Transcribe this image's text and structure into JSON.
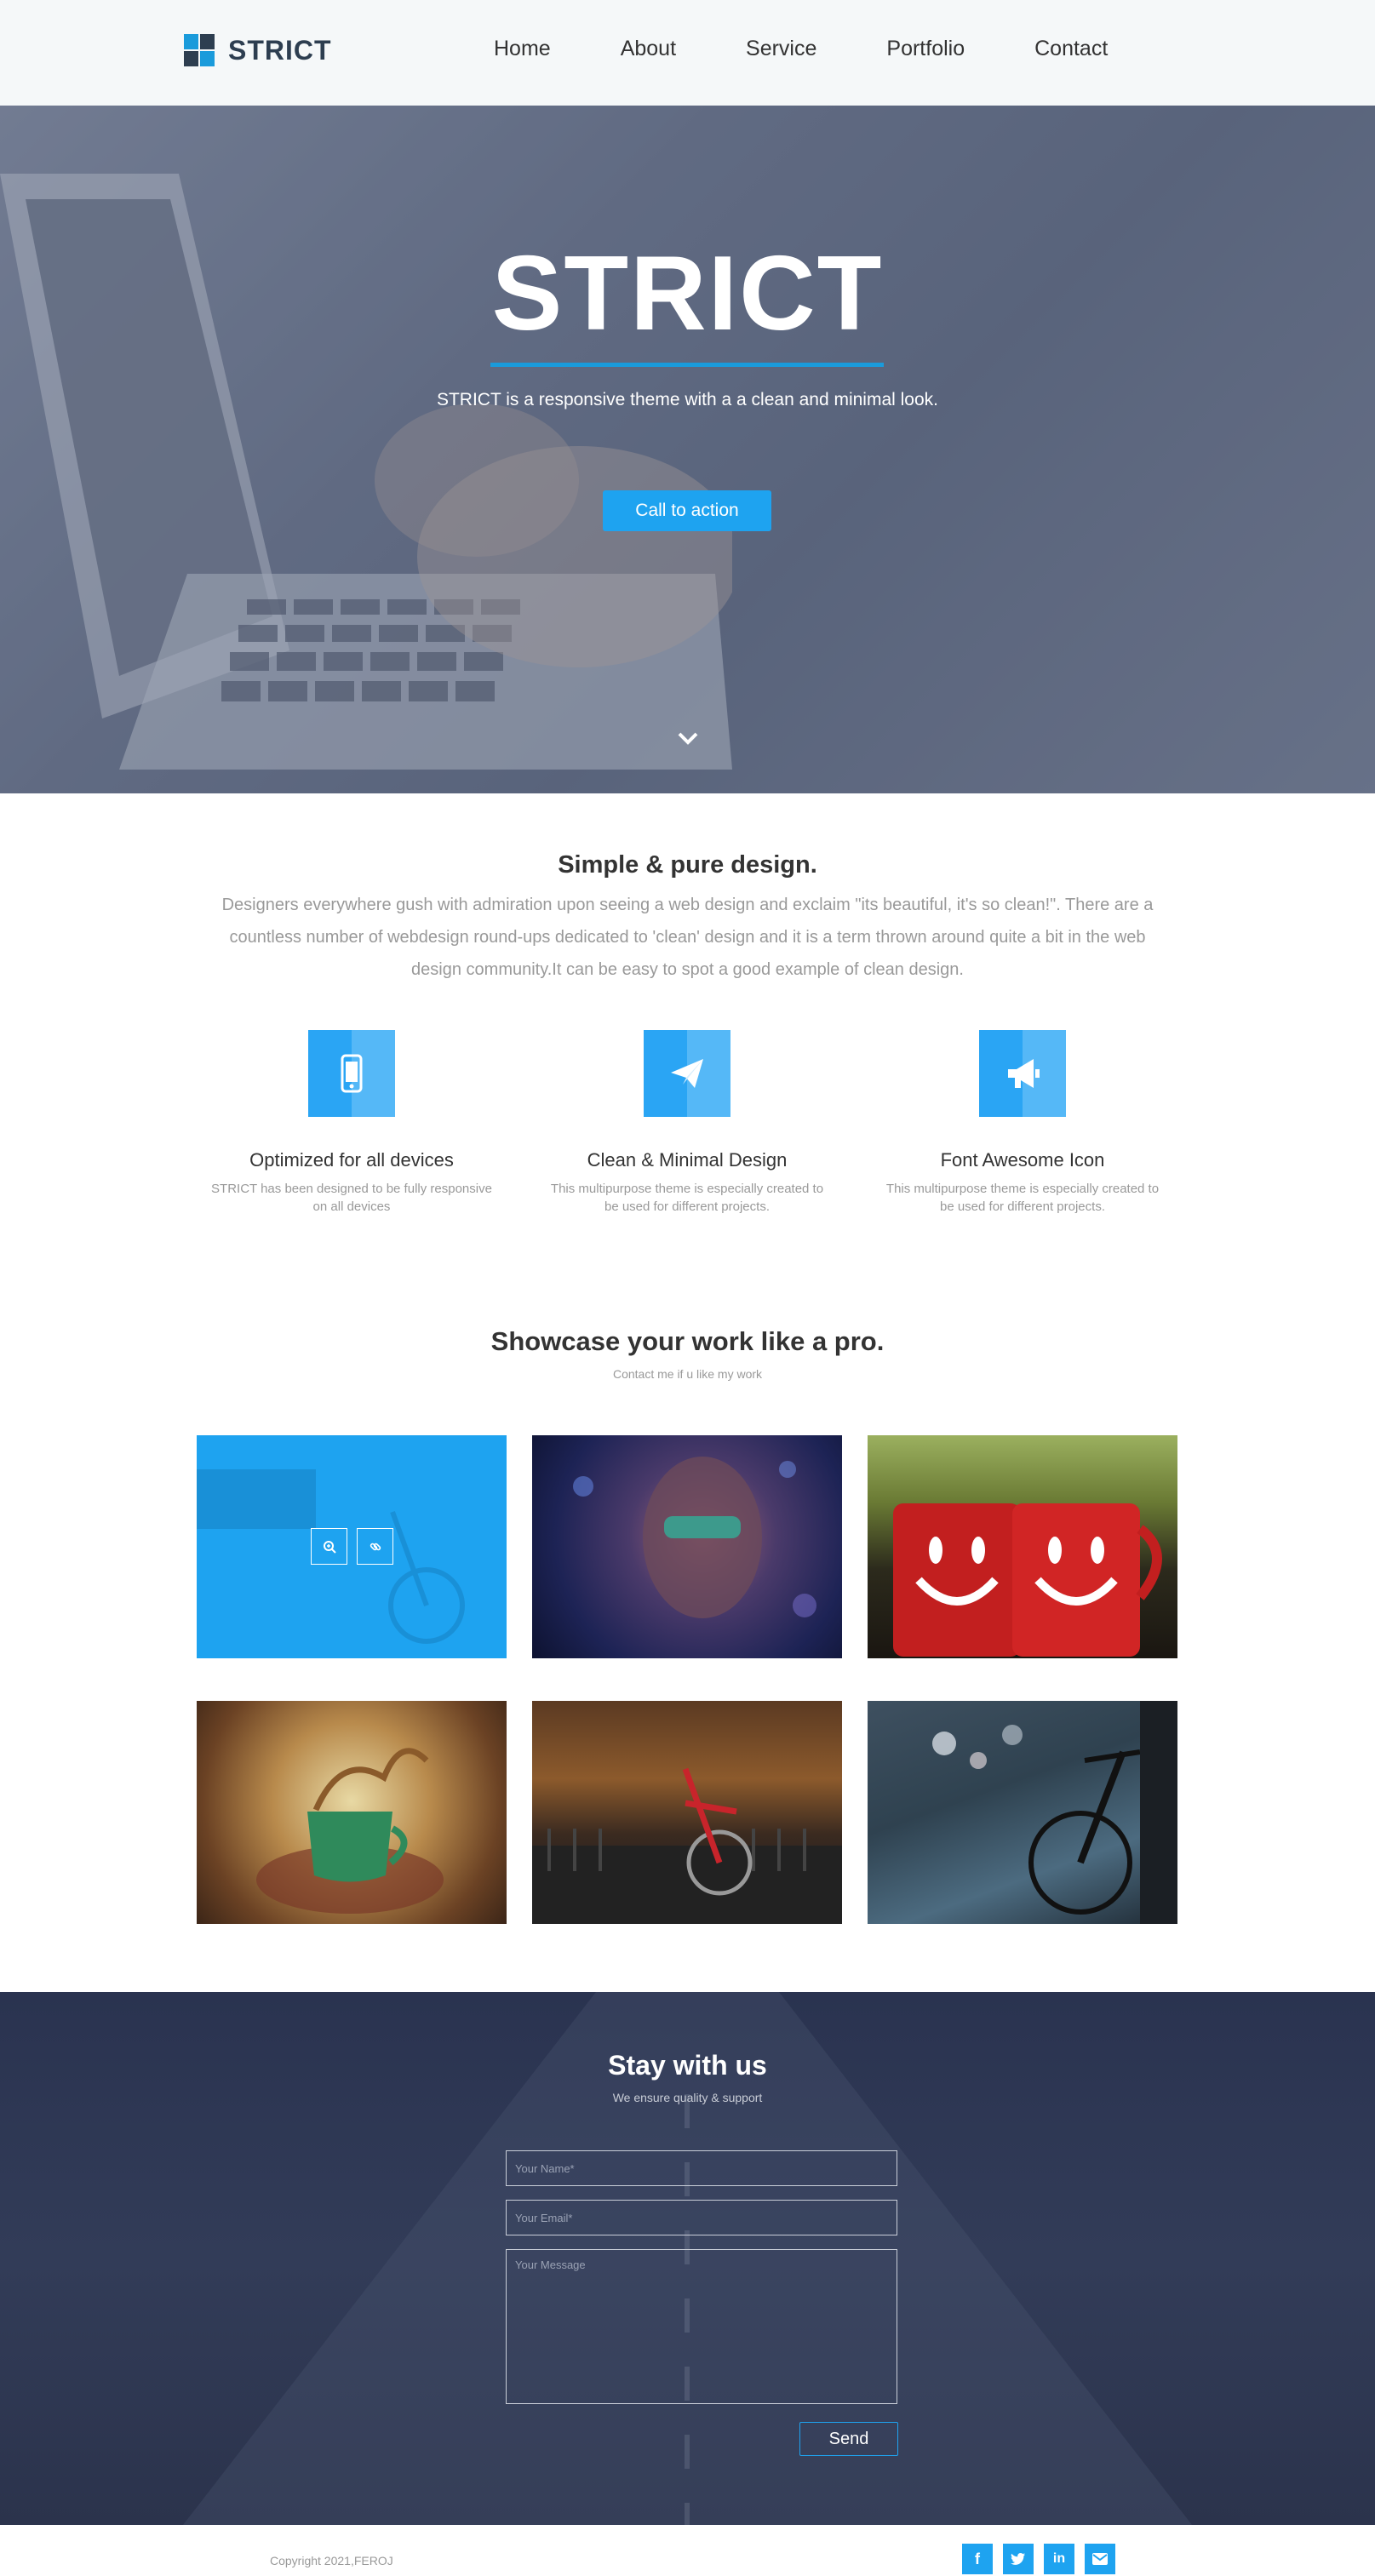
{
  "brand": {
    "name": "STRICT",
    "accent": "#1a9bdb"
  },
  "nav": {
    "items": [
      "Home",
      "About",
      "Service",
      "Portfolio",
      "Contact"
    ]
  },
  "hero": {
    "title": "STRICT",
    "subtitle": "STRICT is a responsive theme with a a clean and minimal look.",
    "cta": "Call to action"
  },
  "about": {
    "title": "Simple & pure design.",
    "description": "Designers everywhere gush with admiration upon seeing a web design and exclaim \"its beautiful, it's so clean!\". There are a countless number of webdesign round-ups dedicated to 'clean' design and it is a term thrown around quite a bit in the web design community.It can be easy to spot a good example of clean design.",
    "features": [
      {
        "icon": "mobile-icon",
        "title": "Optimized for all devices",
        "text": "STRICT has been designed to be fully responsive on all devices"
      },
      {
        "icon": "paper-plane-icon",
        "title": "Clean & Minimal Design",
        "text": "This multipurpose theme is especially created to be used for different projects."
      },
      {
        "icon": "bullhorn-icon",
        "title": "Font Awesome Icon",
        "text": "This multipurpose theme is especially created to be used for different projects."
      }
    ]
  },
  "showcase": {
    "title": "Showcase your work like a pro.",
    "subtitle": "Contact me if u like my work"
  },
  "contact": {
    "title": "Stay with us",
    "subtitle": "We ensure quality & support",
    "name_placeholder": "Your Name*",
    "email_placeholder": "Your Email*",
    "message_placeholder": "Your Message",
    "send": "Send"
  },
  "footer": {
    "copyright": "Copyright 2021,FEROJ",
    "socials": [
      "facebook-icon",
      "twitter-icon",
      "linkedin-icon",
      "envelope-icon"
    ]
  }
}
